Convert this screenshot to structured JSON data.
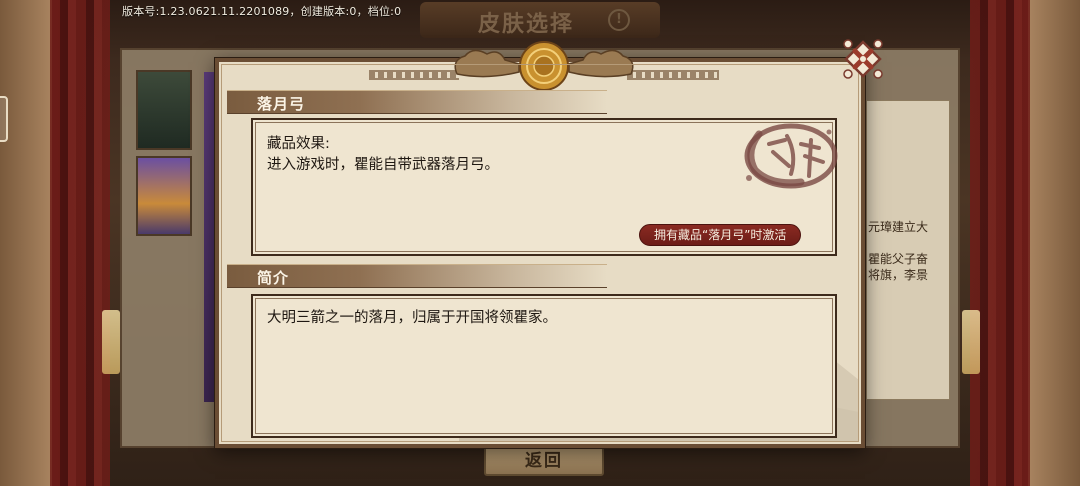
{
  "version_text": "版本号:1.23.0621.11.2201089，创建版本:0，档位:0",
  "background": {
    "title": "皮肤选择",
    "title_badge": "!",
    "side_text_lines": [
      "元璋建立大",
      "瞿能父子奋",
      "将旗，李景"
    ],
    "back_label": "返回"
  },
  "dialog": {
    "item_name": "落月弓",
    "effect_title": "藏品效果:",
    "effect_text": "进入游戏时，瞿能自带武器落月弓。",
    "activation_badge": "拥有藏品“落月弓”时激活",
    "intro_header": "简介",
    "intro_text": "大明三箭之一的落月，归属于开国将领瞿家。"
  },
  "colors": {
    "dialog_bg": "#e7dcc5",
    "header_brown": "#8f7052",
    "badge_red": "#7a2520",
    "seal_maroon": "#7a4a44"
  },
  "icons": {
    "close": "ornate-close-icon",
    "seal": "calligraphy-seal-icon",
    "ornament": "cloud-ornament-icon"
  }
}
